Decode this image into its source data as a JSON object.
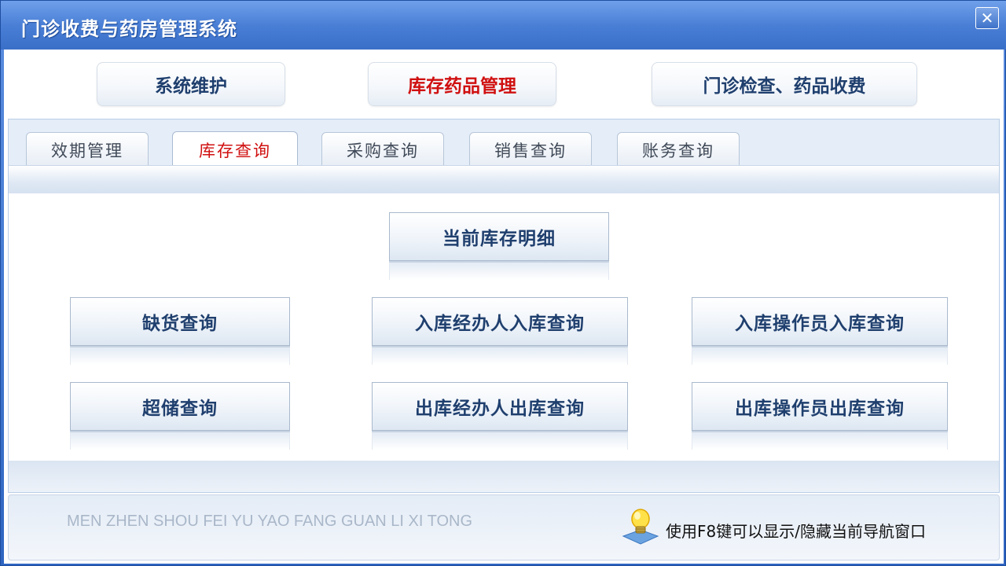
{
  "window": {
    "title": "门诊收费与药房管理系统",
    "close_symbol": "✕"
  },
  "modules": [
    {
      "label": "系统维护",
      "active": false
    },
    {
      "label": "库存药品管理",
      "active": true
    },
    {
      "label": "门诊检查、药品收费",
      "active": false
    }
  ],
  "tabs": [
    {
      "label": "效期管理",
      "active": false
    },
    {
      "label": "库存查询",
      "active": true
    },
    {
      "label": "采购查询",
      "active": false
    },
    {
      "label": "销售查询",
      "active": false
    },
    {
      "label": "账务查询",
      "active": false
    }
  ],
  "queries": {
    "current_stock": "当前库存明细",
    "shortage": "缺货查询",
    "inbound_handler": "入库经办人入库查询",
    "inbound_operator": "入库操作员入库查询",
    "overstock": "超储查询",
    "outbound_handler": "出库经办人出库查询",
    "outbound_operator": "出库操作员出库查询"
  },
  "footer": {
    "pinyin": "MEN ZHEN SHOU FEI YU YAO FANG GUAN LI XI TONG",
    "hint": "使用F8键可以显示/隐藏当前导航窗口",
    "hint_icon": "lightbulb-icon"
  },
  "colors": {
    "title_bar": "#4a7fd6",
    "active_red": "#d01010",
    "button_text": "#1f3f6e"
  }
}
